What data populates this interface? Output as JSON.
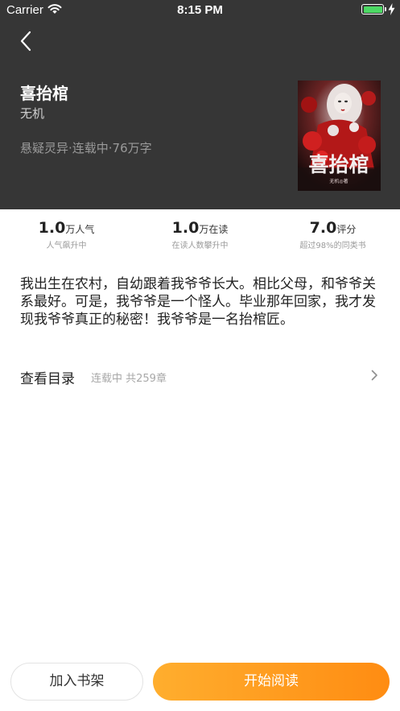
{
  "status_bar": {
    "carrier": "Carrier",
    "time": "8:15 PM"
  },
  "book": {
    "title": "喜抬棺",
    "author": "无机",
    "meta": "悬疑灵异·连载中·76万字",
    "cover": {
      "title_text": "喜抬棺",
      "author_text": "无机◎著"
    }
  },
  "stats": [
    {
      "value": "1.0",
      "unit": "万人气",
      "sub": "人气飙升中"
    },
    {
      "value": "1.0",
      "unit": "万在读",
      "sub": "在读人数攀升中"
    },
    {
      "value": "7.0",
      "unit": "评分",
      "sub": "超过98%的同类书"
    }
  ],
  "description": "我出生在农村，自幼跟着我爷爷长大。相比父母，和爷爷关系最好。可是，我爷爷是一个怪人。毕业那年回家，我才发现我爷爷真正的秘密！我爷爷是一名抬棺匠。",
  "toc": {
    "label": "查看目录",
    "status": "连载中 共259章"
  },
  "actions": {
    "add_shelf": "加入书架",
    "start_reading": "开始阅读"
  },
  "colors": {
    "header_bg": "#363636",
    "accent_orange": "#ff9a1f",
    "battery_green": "#4cd964"
  }
}
